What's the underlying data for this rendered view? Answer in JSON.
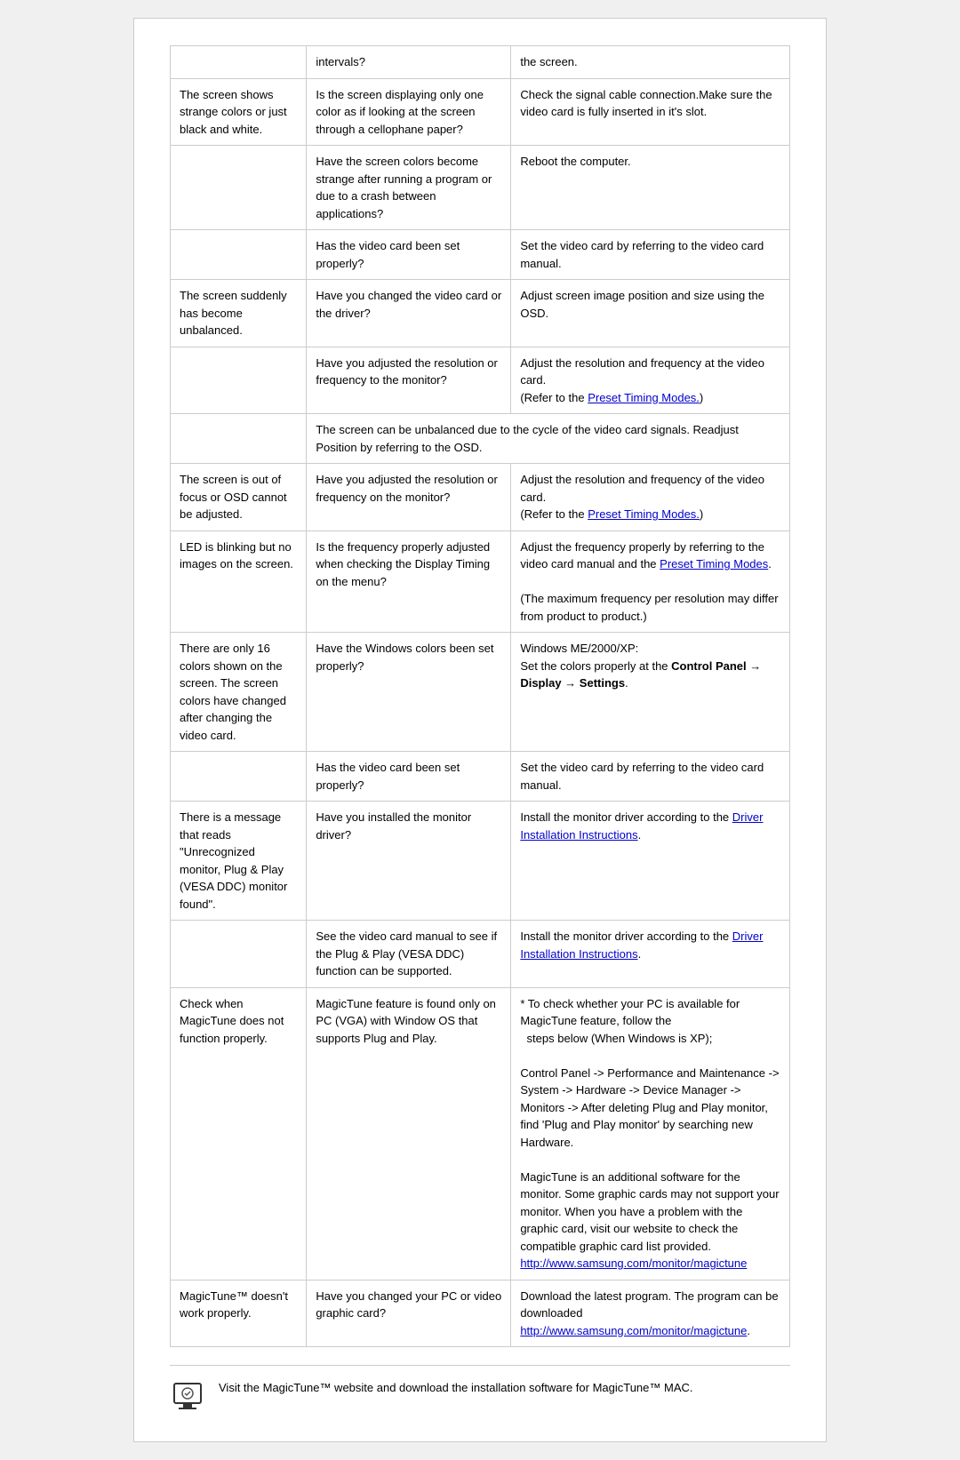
{
  "table": {
    "rows": [
      {
        "col1": "",
        "col2": "intervals?",
        "col3": "the screen."
      },
      {
        "col1": "The screen shows strange colors or just black and white.",
        "col2": "Is the screen displaying only one color as if looking at the screen through a cellophane paper?",
        "col3": "Check the signal cable connection.Make sure the video card is fully inserted in it's slot."
      },
      {
        "col1": "",
        "col2": "Have the screen colors become strange after running a program or due to a crash between applications?",
        "col3": "Reboot the computer."
      },
      {
        "col1": "",
        "col2": "Has the video card been set properly?",
        "col3": "Set the video card by referring to the video card manual."
      },
      {
        "col1": "The screen suddenly has become unbalanced.",
        "col2": "Have you changed the video card or the driver?",
        "col3": "Adjust screen image position and size using the OSD."
      },
      {
        "col1": "",
        "col2": "Have you adjusted the resolution or frequency to the monitor?",
        "col3_prefix": "Adjust the resolution and frequency at the video card.",
        "col3_link": "Preset Timing Modes.",
        "col3_link_prefix": "(Refer to the ",
        "col3_link_suffix": ")"
      },
      {
        "col1": "",
        "col2_span": "The screen can be unbalanced due to the cycle of the video card signals. Readjust Position by referring to the OSD.",
        "col2_colspan": true
      },
      {
        "col1": "The screen is out of focus or OSD cannot be adjusted.",
        "col2": "Have you adjusted the resolution or frequency on the monitor?",
        "col3_prefix": "Adjust the resolution and frequency of the video card.",
        "col3_link": "Preset Timing Modes.",
        "col3_link_prefix": "(Refer to the ",
        "col3_link_suffix": ")"
      },
      {
        "col1": "LED is blinking but no images on the screen.",
        "col2": "Is the frequency properly adjusted when checking the Display Timing on the menu?",
        "col3_prefix": "Adjust the frequency properly by referring to the video card manual and the ",
        "col3_link": "Preset Timing Modes",
        "col3_link_suffix": ".\n\n(The maximum frequency per resolution may differ from product to product.)"
      },
      {
        "col1": "There are only 16 colors shown on the screen. The screen colors have changed after changing the video card.",
        "col2": "Have the Windows colors been set properly?",
        "col3_special": "windows_colors"
      },
      {
        "col1": "",
        "col2": "Has the video card been set properly?",
        "col3": "Set the video card by referring to the video card manual."
      },
      {
        "col1": "There is a message that reads \"Unrecognized monitor, Plug & Play (VESA DDC) monitor found\".",
        "col2": "Have you installed the monitor driver?",
        "col3_prefix": "Install the monitor driver according to the ",
        "col3_link": "Driver Installation Instructions",
        "col3_link_suffix": "."
      },
      {
        "col1": "",
        "col2": "See the video card manual to see if the Plug & Play (VESA DDC) function can be supported.",
        "col3_prefix": "Install the monitor driver according to the ",
        "col3_link": "Driver Installation Instructions",
        "col3_link_suffix": "."
      },
      {
        "col1": "Check when MagicTune does not function properly.",
        "col2": "MagicTune feature is found only on PC (VGA) with Window OS that supports Plug and Play.",
        "col3": "* To check whether your PC is available for MagicTune feature, follow the\n  steps below (When Windows is XP);\n\nControl Panel -> Performance and Maintenance -> System -> Hardware -> Device Manager -> Monitors -> After deleting Plug and Play monitor, find 'Plug and Play monitor' by searching new Hardware.\n\nMagicTune is an additional software for the monitor. Some graphic cards may not support your monitor. When you have a problem with the graphic card, visit our website to check the compatible graphic card list provided.",
        "col3_link": "http://www.samsung.com/monitor/magictune"
      },
      {
        "col1": "MagicTune™ doesn't work properly.",
        "col2": "Have you changed your PC or video graphic card?",
        "col3_prefix": "Download the latest program. The program can be downloaded ",
        "col3_link": "http://www.samsung.com/monitor/magictune",
        "col3_link_suffix": "."
      }
    ],
    "footer_text": "Visit the MagicTune™ website and download the installation software for MagicTune™ MAC."
  }
}
